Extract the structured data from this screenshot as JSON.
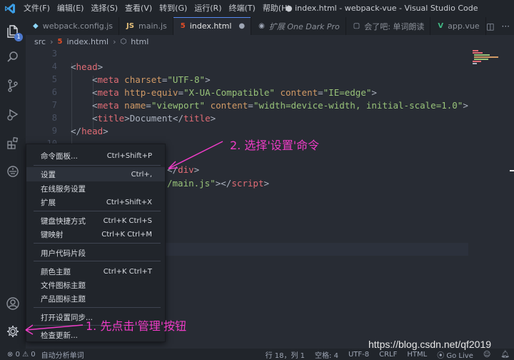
{
  "titlebar": {
    "menus": [
      "文件(F)",
      "编辑(E)",
      "选择(S)",
      "查看(V)",
      "转到(G)",
      "运行(R)",
      "终端(T)",
      "帮助(H)"
    ],
    "title": "● index.html - webpack-vue - Visual Studio Code"
  },
  "activity": {
    "explorer_badge": "1"
  },
  "tabs": [
    {
      "icon": "◆",
      "icon_color": "#8dd6f9",
      "label": "webpack.config.js",
      "italic": false,
      "active": false
    },
    {
      "icon": "JS",
      "icon_color": "#e5c07b",
      "label": "main.js",
      "italic": false,
      "active": false
    },
    {
      "icon": "5",
      "icon_color": "#e44d26",
      "label": "index.html",
      "italic": false,
      "active": true,
      "close": "●"
    },
    {
      "icon": "◉",
      "icon_color": "#9da5b4",
      "label": "扩展 One Dark Pro",
      "italic": true,
      "active": false
    },
    {
      "icon": "▢",
      "icon_color": "#9da5b4",
      "label": "会了吧: 单词朗读",
      "italic": false,
      "active": false
    },
    {
      "icon": "V",
      "icon_color": "#41b883",
      "label": "app.vue",
      "italic": false,
      "active": false
    }
  ],
  "breadcrumb": {
    "folder": "src",
    "file": "index.html",
    "node": "html"
  },
  "editor": {
    "line_numbers": [
      "3",
      "4",
      "5",
      "6",
      "7",
      "8",
      "9",
      "10"
    ],
    "lines": {
      "l4_tag": "head",
      "l5_tag": "meta",
      "l5_attr": "charset",
      "l5_val": "\"UTF-8\"",
      "l6_tag": "meta",
      "l6_attr1": "http-equiv",
      "l6_val1": "\"X-UA-Compatible\"",
      "l6_attr2": "content",
      "l6_val2": "\"IE=edge\"",
      "l7_tag": "meta",
      "l7_attr1": "name",
      "l7_val1": "\"viewport\"",
      "l7_attr2": "content",
      "l7_val2": "\"width=device-width, initial-scale=1.0\"",
      "l8_tag": "title",
      "l8_text": "Document",
      "l9_tag": "head",
      "frag1_tag": "div",
      "frag2_val": "/main.js\"",
      "frag2_tag": "script"
    }
  },
  "context_menu": {
    "items": [
      {
        "label": "命令面板...",
        "shortcut": "Ctrl+Shift+P"
      },
      {
        "label": "设置",
        "shortcut": "Ctrl+,"
      },
      {
        "label": "在线服务设置",
        "shortcut": ""
      },
      {
        "label": "扩展",
        "shortcut": "Ctrl+Shift+X"
      },
      {
        "label": "键盘快捷方式",
        "shortcut": "Ctrl+K Ctrl+S"
      },
      {
        "label": "键映射",
        "shortcut": "Ctrl+K Ctrl+M"
      },
      {
        "label": "用户代码片段",
        "shortcut": ""
      },
      {
        "label": "颜色主题",
        "shortcut": "Ctrl+K Ctrl+T"
      },
      {
        "label": "文件图标主题",
        "shortcut": ""
      },
      {
        "label": "产品图标主题",
        "shortcut": ""
      },
      {
        "label": "打开设置同步...",
        "shortcut": ""
      },
      {
        "label": "检查更新...",
        "shortcut": ""
      }
    ]
  },
  "annotations": {
    "step1": "1. 先点击'管理'按钮",
    "step2": "2. 选择'设置'命令",
    "color": "#ee3cc6"
  },
  "statusbar": {
    "errors": "0",
    "warnings": "0",
    "task": "自动分析单词",
    "position": "行 18，列 1",
    "spaces": "空格: 4",
    "encoding": "UTF-8",
    "eol": "CRLF",
    "language": "HTML",
    "golive": "Go Live"
  },
  "watermark": "https://blog.csdn.net/qf2019"
}
